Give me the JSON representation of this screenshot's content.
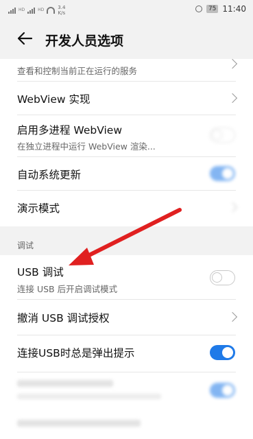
{
  "status_bar": {
    "net_tag_1": "HD",
    "net_tag_2": "HD",
    "speed_value": "3.4",
    "speed_unit": "K/s",
    "battery": "75",
    "time": "11:40"
  },
  "header": {
    "title": "开发人员选项"
  },
  "rows": {
    "running_services": {
      "subtitle": "查看和控制当前正在运行的服务"
    },
    "webview": {
      "title": "WebView 实现"
    },
    "multiprocess": {
      "title": "启用多进程 WebView",
      "subtitle": "在独立进程中运行 WebView 渲染..."
    },
    "auto_update": {
      "title": "自动系统更新",
      "state": "on"
    },
    "demo_mode": {
      "title": "演示模式"
    },
    "debug_section": {
      "label": "调试"
    },
    "usb_debug": {
      "title": "USB 调试",
      "subtitle": "连接 USB 后开启调试模式",
      "state": "off"
    },
    "revoke_usb": {
      "title": "撤消 USB 调试授权"
    },
    "usb_prompt": {
      "title": "连接USB时总是弹出提示",
      "state": "on"
    }
  },
  "colors": {
    "accent": "#1f7ae8",
    "annotation": "#e02020",
    "background": "#f2f2f2"
  },
  "icons": [
    "back-arrow-icon",
    "chevron-right-icon",
    "toggle-switch",
    "signal-icon",
    "wifi-icon",
    "alarm-icon",
    "battery-icon"
  ]
}
